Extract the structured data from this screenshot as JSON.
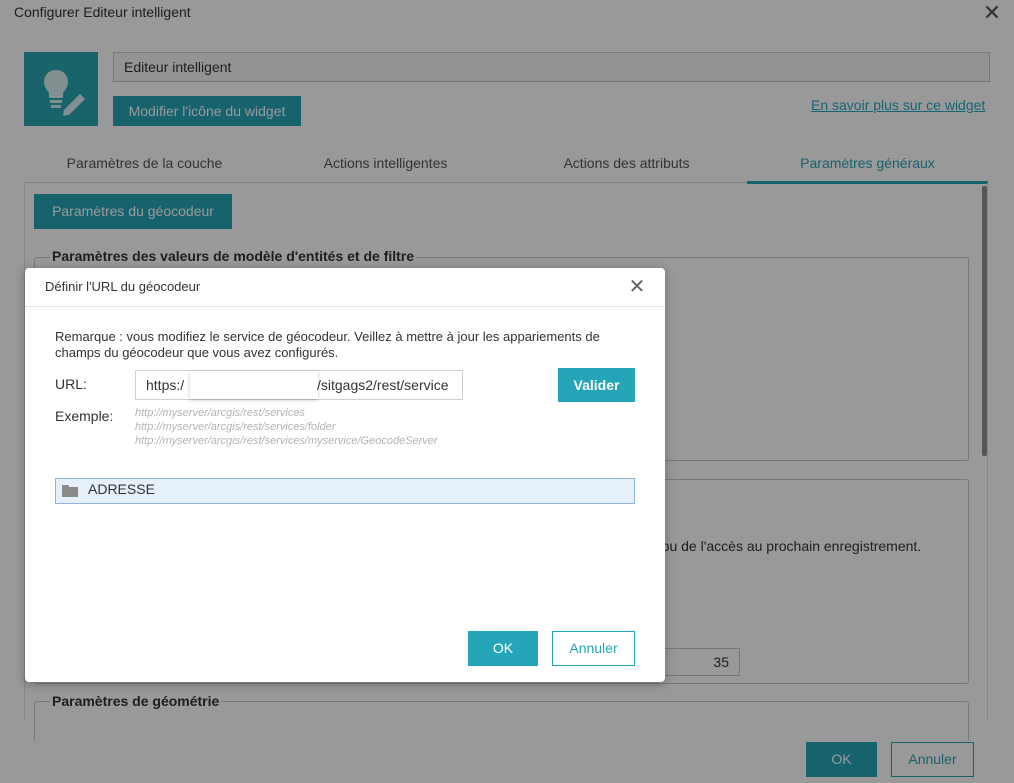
{
  "window": {
    "title": "Configurer Editeur intelligent",
    "close_icon": "close-icon"
  },
  "widget": {
    "name": "Editeur intelligent",
    "change_icon_label": "Modifier l'icône du widget",
    "learn_more_label": "En savoir plus sur ce widget",
    "icon": "lightbulb-pencil-icon"
  },
  "tabs": [
    {
      "label": "Paramètres de la couche",
      "active": false
    },
    {
      "label": "Actions intelligentes",
      "active": false
    },
    {
      "label": "Actions des attributs",
      "active": false
    },
    {
      "label": "Paramètres généraux",
      "active": true
    }
  ],
  "general": {
    "geocoder_button": "Paramètres du géocodeur",
    "template_legend": "Paramètres des valeurs de modèle d'entités et de filtre",
    "partial_text": "e ou de l'accès au prochain enregistrement.",
    "number_value": "35",
    "geometry_legend": "Paramètres de géométrie"
  },
  "footer": {
    "ok_label": "OK",
    "cancel_label": "Annuler"
  },
  "modal": {
    "title": "Définir l'URL du géocodeur",
    "note": "Remarque : vous modifiez le service de géocodeur. Veillez à mettre à jour les appariements de champs du géocodeur que vous avez configurés.",
    "url_label": "URL:",
    "url_prefix": "https:/",
    "url_suffix": "/sitgags2/rest/service",
    "validate_label": "Valider",
    "example_label": "Exemple:",
    "examples": [
      "http://myserver/arcgis/rest/services",
      "http://myserver/arcgis/rest/services/folder",
      "http://myserver/arcgis/rest/services/myservice/GeocodeServer"
    ],
    "folder_item": "ADRESSE",
    "ok_label": "OK",
    "cancel_label": "Annuler"
  },
  "colors": {
    "accent": "#25a6b8",
    "icon_bg": "#2aa6b3"
  }
}
